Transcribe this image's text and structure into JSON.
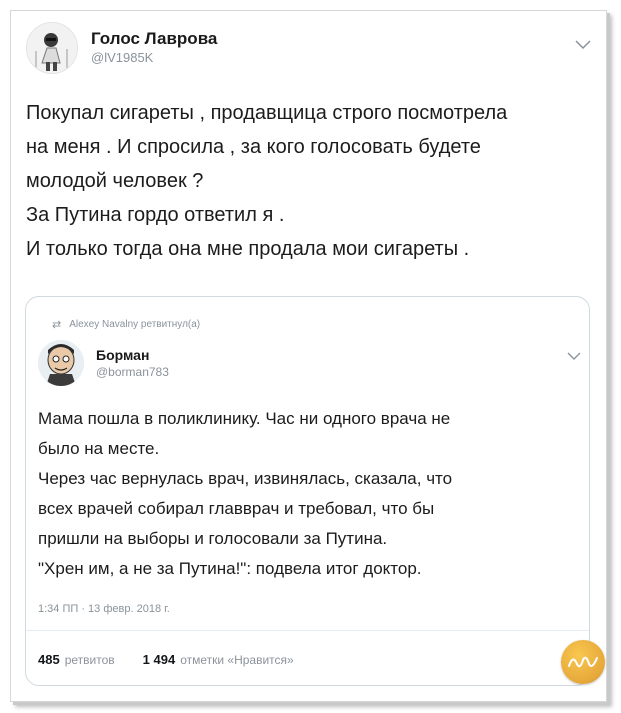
{
  "outer_tweet": {
    "display_name": "Голос Лаврова",
    "handle": "@lV1985K",
    "lines": [
      "Покупал сигареты , продавщица строго посмотрела",
      "на меня . И спросила , за кого голосовать будете",
      "молодой человек ?",
      "За Путина гордо ответил я .",
      "И только тогда она мне продала мои сигареты ."
    ]
  },
  "quoted_tweet": {
    "retweet_notice": "Alexey Navalny ретвитнул(а)",
    "display_name": "Борман",
    "handle": "@borman783",
    "lines": [
      "Мама пошла в поликлинику. Час ни одного врача не",
      "было на месте.",
      "Через час вернулась врач, извинялась, сказала, что",
      "всех врачей собирал главврач и требовал, что бы",
      "пришли на выборы и голосовали за Путина.",
      "\"Хрен им, а не за Путина!\": подвела итог доктор."
    ],
    "timestamp": "1:34 ПП · 13 февр. 2018 г.",
    "retweets_count": "485",
    "retweets_label": "ретвитов",
    "likes_count": "1 494",
    "likes_label": "отметки «Нравится»"
  },
  "icons": {
    "menu_chevron": "chevron-down-icon",
    "retweet": "retweet-icon",
    "watermark": "watermark-logo-icon"
  },
  "colors": {
    "text": "#1c1c1c",
    "muted": "#8a939b",
    "border": "#cfd9de",
    "watermark": "#e6a83b"
  }
}
